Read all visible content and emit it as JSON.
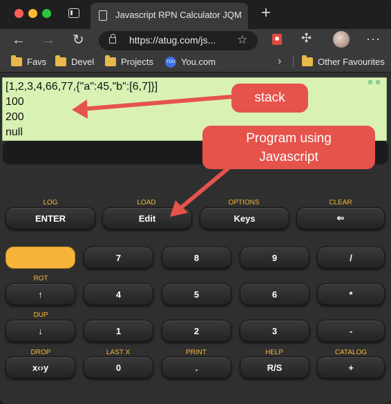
{
  "browser": {
    "tab_title": "Javascript RPN Calculator JQM",
    "url": "https://atug.com/js...",
    "icons": [
      "tab-actions-icon",
      "back-icon",
      "forward-icon",
      "reload-icon",
      "lock-icon",
      "add-favourite-icon",
      "extension-icon",
      "puzzle-icon",
      "avatar",
      "more-icon"
    ],
    "nav_glyphs": {
      "back": "←",
      "forward": "→",
      "reload": "↻",
      "new_tab": "+",
      "add_favourite": "☆",
      "puzzle": "✣",
      "more": "···",
      "chevron": "›"
    },
    "favourites": [
      {
        "label": "Favs"
      },
      {
        "label": "Devel"
      },
      {
        "label": "Projects"
      },
      {
        "label": "You.com",
        "icon_text": "YOU"
      }
    ],
    "other_favourites": "Other Favourites"
  },
  "calculator": {
    "stack_lines": [
      "[1,2,3,4,66,77,{\"a\":45,\"b\":[6,7]}]",
      "100",
      "200",
      "null"
    ],
    "entry_value": "",
    "function_rows": [
      {
        "labels": [
          "LOG",
          "LOAD",
          "OPTIONS",
          "CLEAR"
        ],
        "keys": [
          "ENTER",
          "Edit",
          "Keys",
          "⇐"
        ]
      }
    ],
    "keypad": [
      {
        "fn_labels": [
          "",
          "",
          "",
          "",
          ""
        ],
        "keys": [
          "",
          "7",
          "8",
          "9",
          "/"
        ]
      },
      {
        "fn_labels": [
          "ROT",
          "",
          "",
          "",
          ""
        ],
        "keys": [
          "↑",
          "4",
          "5",
          "6",
          "*"
        ]
      },
      {
        "fn_labels": [
          "DUP",
          "",
          "",
          "",
          ""
        ],
        "keys": [
          "↓",
          "1",
          "2",
          "3",
          "-"
        ]
      },
      {
        "fn_labels": [
          "DROP",
          "LAST X",
          "PRINT",
          "HELP",
          "CATALOG"
        ],
        "keys": [
          "x‹›y",
          "0",
          ".",
          "R/S",
          "+"
        ]
      }
    ],
    "shift_key_color": "#f7b43a",
    "fn_label_color": "#f4b738"
  },
  "annotations": {
    "stack_callout": "stack",
    "program_callout_line1": "Program using",
    "program_callout_line2": "Javascript",
    "callout_color": "#e5534b"
  }
}
